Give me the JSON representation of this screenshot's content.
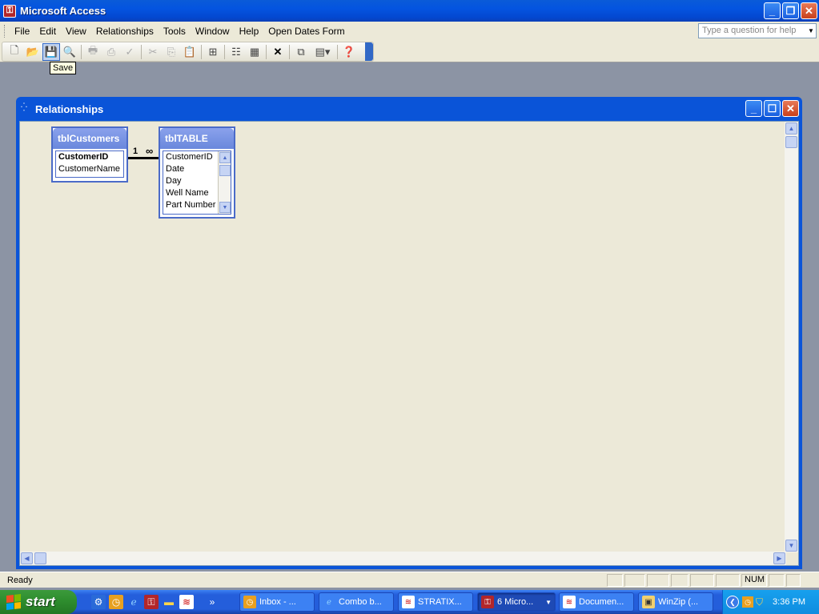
{
  "window": {
    "title": "Microsoft Access"
  },
  "menu": {
    "items": [
      "File",
      "Edit",
      "View",
      "Relationships",
      "Tools",
      "Window",
      "Help",
      "Open Dates Form"
    ],
    "help_placeholder": "Type a question for help"
  },
  "toolbar": {
    "tooltip": "Save"
  },
  "relationships_window": {
    "title": "Relationships",
    "tables": [
      {
        "name": "tblCustomers",
        "fields": [
          "CustomerID",
          "CustomerName"
        ],
        "key_field": "CustomerID"
      },
      {
        "name": "tblTABLE",
        "fields": [
          "CustomerID",
          "Date",
          "Day",
          "Well Name",
          "Part Number"
        ]
      }
    ],
    "relationship": {
      "one_label": "1",
      "many_label": "∞"
    }
  },
  "statusbar": {
    "text": "Ready",
    "num": "NUM"
  },
  "taskbar": {
    "start_label": "start",
    "tasks": [
      {
        "label": "Inbox - ...",
        "icon": "outlook-icon"
      },
      {
        "label": "Combo b...",
        "icon": "ie-icon"
      },
      {
        "label": "STRATIX...",
        "icon": "stratix-icon"
      },
      {
        "label": "6 Micro...",
        "icon": "access-icon",
        "active": true
      },
      {
        "label": "Documen...",
        "icon": "stratix-icon"
      },
      {
        "label": "WinZip (...",
        "icon": "winzip-icon"
      }
    ],
    "clock": "3:36 PM",
    "overflow_chevron": "»"
  },
  "colors": {
    "title_blue": "#0454e0",
    "panel_beige": "#ece9d8",
    "start_green": "#2f8f2f",
    "close_red": "#c8401c"
  }
}
